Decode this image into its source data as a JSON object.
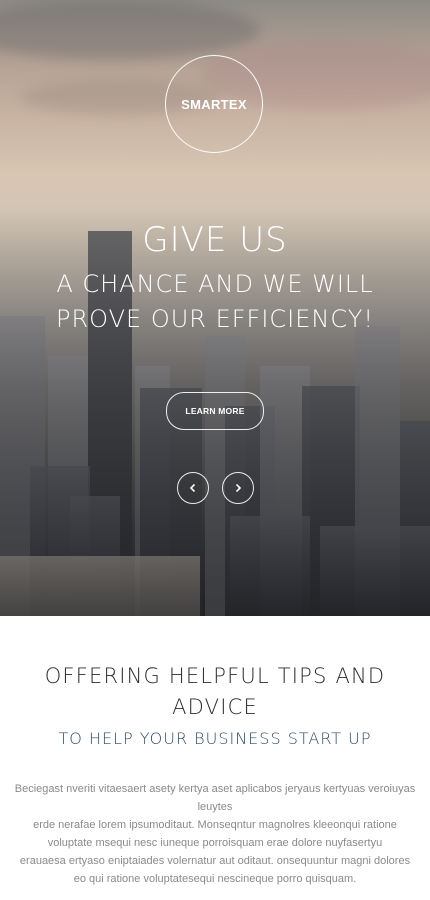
{
  "hero": {
    "logo_text": "SMARTEX",
    "headline_1": "GIVE US",
    "headline_2": "A CHANCE AND WE WILL",
    "headline_3": "PROVE OUR EFFICIENCY!",
    "cta_label": "LEARN MORE",
    "prev_icon": "chevron-left-icon",
    "next_icon": "chevron-right-icon"
  },
  "section": {
    "title": "OFFERING HELPFUL TIPS AND ADVICE",
    "subtitle": "TO HELP YOUR BUSINESS START UP",
    "paragraph_lines": [
      "Beciegast nveriti vitaesaert asety kertya aset aplicabos jeryaus kertyuas veroiuyas leuytes",
      "erde nerafae lorem ipsumoditaut. Monseqntur magnolres kleeonqui ratione",
      "voluptate msequi nesc iuneque porroisquam erae dolore nuyfasertyu",
      "erauaesa ertyaso eniptaiades volernatur aut oditaut. onsequuntur magni dolores",
      "eo qui ratione voluptatesequi nescineque porro quisquam."
    ]
  },
  "colors": {
    "title_text": "#2b2b2b",
    "subtitle_text": "#2c4a67",
    "body_text": "#8a8a8a"
  }
}
